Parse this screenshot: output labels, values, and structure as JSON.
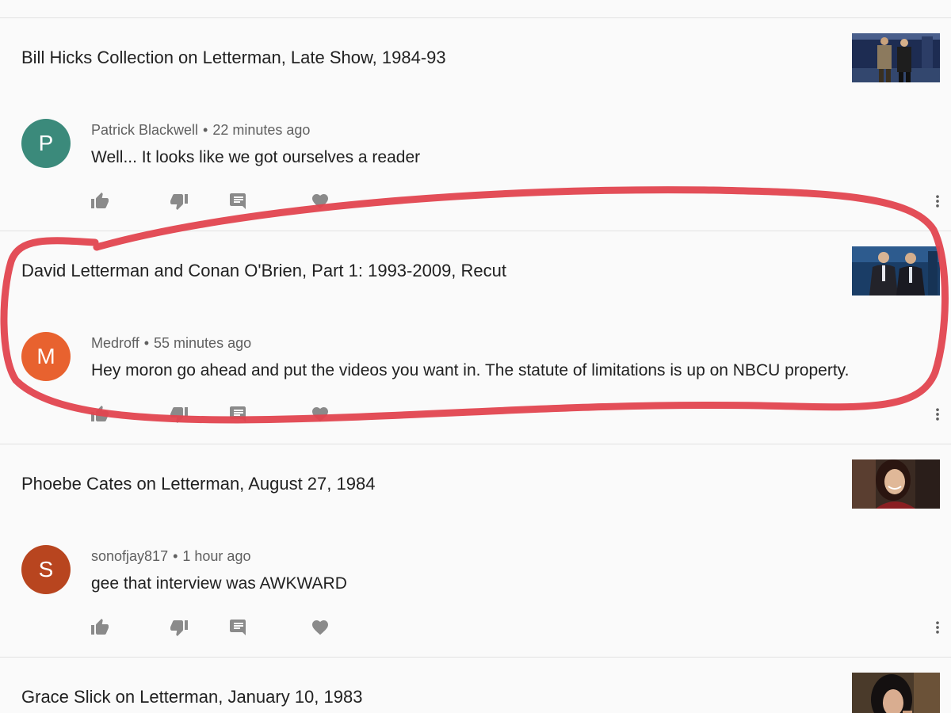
{
  "feed": {
    "items": [
      {
        "video_title": "Bill Hicks Collection on Letterman, Late Show, 1984-93",
        "thumbnail": "two-men-on-stage",
        "comment": {
          "avatar_letter": "P",
          "avatar_color": "#3b8a7b",
          "author": "Patrick Blackwell",
          "time": "22 minutes ago",
          "text": "Well... It looks like we got ourselves a reader"
        }
      },
      {
        "video_title": "David Letterman and Conan O'Brien, Part 1: 1993-2009, Recut",
        "thumbnail": "two-men-in-suits",
        "comment": {
          "avatar_letter": "M",
          "avatar_color": "#e8622f",
          "author": "Medroff",
          "time": "55 minutes ago",
          "text": "Hey moron go ahead and put the videos you want in. The statute of limitations is up on NBCU property."
        }
      },
      {
        "video_title": "Phoebe Cates on Letterman, August 27, 1984",
        "thumbnail": "woman-smiling",
        "comment": {
          "avatar_letter": "S",
          "avatar_color": "#b8451f",
          "author": "sonofjay817",
          "time": "1 hour ago",
          "text": "gee that interview was AWKWARD"
        }
      },
      {
        "video_title": "Grace Slick on Letterman, January 10, 1983",
        "thumbnail": "woman-dark-hair"
      }
    ],
    "separator": "•"
  },
  "icons": {
    "like": "thumb-up-icon",
    "dislike": "thumb-down-icon",
    "reply": "comment-icon",
    "heart": "heart-icon",
    "more": "more-vert-icon"
  },
  "colors": {
    "annotation": "#e2444f",
    "divider": "#e2e2e2",
    "icon": "#8a8a8a"
  }
}
